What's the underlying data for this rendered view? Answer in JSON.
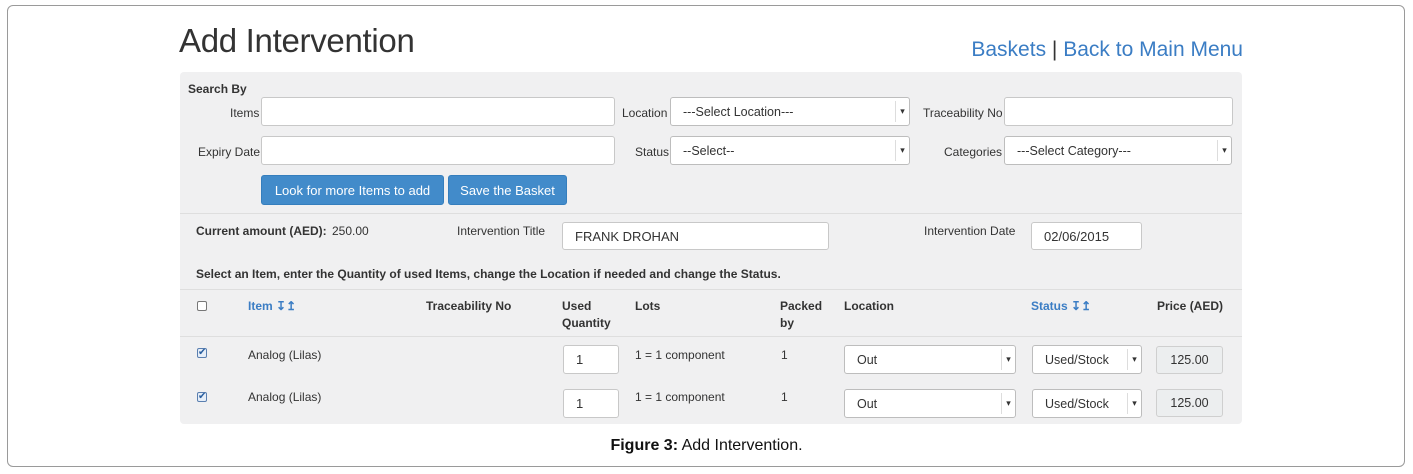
{
  "header": {
    "title": "Add Intervention",
    "baskets_link": "Baskets",
    "separator": "|",
    "back_link": "Back to Main Menu"
  },
  "search": {
    "heading": "Search By",
    "items_label": "Items",
    "items_value": "",
    "location_label": "Location",
    "location_value": "---Select Location---",
    "traceability_label": "Traceability No",
    "traceability_value": "",
    "expiry_label": "Expiry Date",
    "expiry_value": "",
    "status_label": "Status",
    "status_value": "--Select--",
    "categories_label": "Categories",
    "categories_value": "---Select Category---",
    "look_button": "Look for more Items to add",
    "save_button": "Save the Basket"
  },
  "summary": {
    "amount_label": "Current amount (AED):",
    "amount_value": "250.00",
    "title_label": "Intervention Title",
    "title_value": "FRANK DROHAN",
    "date_label": "Intervention Date",
    "date_value": "02/06/2015"
  },
  "instruction": "Select an Item, enter the Quantity of used Items, change the Location if needed and change the Status.",
  "table": {
    "headers": {
      "item": "Item ↧↥",
      "traceability": "Traceability No",
      "used_qty_1": "Used",
      "used_qty_2": "Quantity",
      "lots": "Lots",
      "packed_1": "Packed",
      "packed_2": "by",
      "location": "Location",
      "status": "Status ↧↥",
      "price": "Price (AED)"
    },
    "rows": [
      {
        "checked": "✔",
        "item": "Analog (Lilas)",
        "qty": "1",
        "lots": "1 = 1 component",
        "packed": "1",
        "location": "Out",
        "status": "Used/Stock",
        "price": "125.00"
      },
      {
        "checked": "✔",
        "item": "Analog (Lilas)",
        "qty": "1",
        "lots": "1 = 1 component",
        "packed": "1",
        "location": "Out",
        "status": "Used/Stock",
        "price": "125.00"
      }
    ]
  },
  "caption": {
    "bold": "Figure 3:",
    "text": " Add Intervention."
  }
}
